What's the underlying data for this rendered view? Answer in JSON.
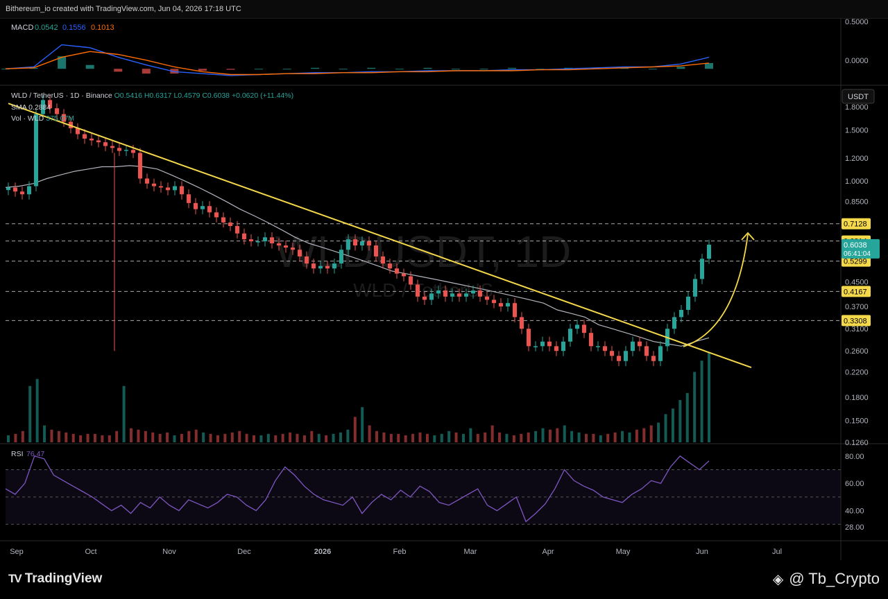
{
  "header": {
    "credit": "Bithereum_io created with TradingView.com, Jun 04, 2026 17:18 UTC"
  },
  "macd": {
    "label": "MACD",
    "v1": "0.0542",
    "v2": "0.1556",
    "v3": "0.1013",
    "ticks": [
      "0.5000",
      "0.0000"
    ]
  },
  "main": {
    "symbol": "WLD / TetherUS · 1D · Binance",
    "ohlc": {
      "o": "O0.5416",
      "h": "H0.6317",
      "l": "L0.4579",
      "c": "C0.6038",
      "chg": "+0.0620 (+11.44%)"
    },
    "sma_label": "SMA",
    "sma_value": "0.2884",
    "vol_label": "Vol · WLD",
    "vol_value": "375.07M",
    "watermark": "WLDUSDT, 1D",
    "watermark_sub": "WLD / TetherUS",
    "currency": "USDT",
    "price_ticks": [
      "1.8000",
      "1.5000",
      "1.2000",
      "1.0000",
      "0.8500",
      "0.4500",
      "0.3700",
      "0.3100",
      "0.2600",
      "0.2200",
      "0.1800",
      "0.1500",
      "0.1260"
    ],
    "levels": [
      "0.7128",
      "0.6214",
      "0.5299",
      "0.4167",
      "0.3308"
    ],
    "last_price": "0.6038",
    "countdown": "06:41:04"
  },
  "rsi": {
    "label": "RSI",
    "value": "76.47",
    "ticks": [
      "80.00",
      "60.00",
      "40.00",
      "28.00"
    ]
  },
  "xaxis": {
    "labels": [
      "Sep",
      "Oct",
      "Nov",
      "Dec",
      "2026",
      "Feb",
      "Mar",
      "Apr",
      "May",
      "Jun",
      "Jul"
    ]
  },
  "footer": {
    "brand": "TradingView",
    "handle": "@ Tb_Crypto"
  },
  "colors": {
    "up": "#26a69a",
    "down": "#ef5350",
    "trendline": "#f5d94a",
    "level": "#f5d94a",
    "sma": "#b2b5be",
    "rsi": "#7e57c2",
    "macd": "#2962ff",
    "signal": "#ff6d00",
    "last": "#26a69a"
  },
  "chart_data": [
    {
      "type": "line",
      "title": "MACD",
      "series": [
        {
          "name": "MACD",
          "values": [
            0.0,
            0.02,
            0.25,
            0.22,
            0.12,
            0.04,
            -0.03,
            -0.05,
            -0.07,
            -0.06,
            -0.05,
            -0.04,
            -0.04,
            -0.03,
            -0.03,
            -0.02,
            -0.02,
            -0.02,
            -0.01,
            -0.01,
            0.0,
            0.01,
            0.02,
            0.02,
            0.05,
            0.12
          ]
        },
        {
          "name": "Signal",
          "values": [
            0.0,
            0.01,
            0.12,
            0.18,
            0.15,
            0.09,
            0.02,
            -0.03,
            -0.06,
            -0.06,
            -0.05,
            -0.05,
            -0.04,
            -0.04,
            -0.03,
            -0.03,
            -0.02,
            -0.02,
            -0.02,
            -0.01,
            -0.01,
            0.0,
            0.01,
            0.02,
            0.03,
            0.06
          ]
        }
      ]
    },
    {
      "type": "line",
      "title": "WLD / TetherUS · 1D · Binance",
      "ylim": [
        0.126,
        2.0
      ],
      "candles": [
        0.95,
        0.92,
        0.9,
        0.96,
        1.7,
        1.9,
        1.78,
        1.7,
        1.6,
        1.52,
        1.45,
        1.4,
        1.38,
        1.36,
        1.32,
        1.3,
        1.27,
        1.28,
        1.25,
        1.02,
        0.98,
        0.96,
        0.95,
        0.93,
        0.96,
        0.9,
        0.84,
        0.8,
        0.82,
        0.78,
        0.75,
        0.72,
        0.7,
        0.66,
        0.63,
        0.62,
        0.62,
        0.64,
        0.61,
        0.6,
        0.59,
        0.58,
        0.55,
        0.52,
        0.5,
        0.51,
        0.5,
        0.52,
        0.58,
        0.63,
        0.6,
        0.62,
        0.6,
        0.55,
        0.52,
        0.5,
        0.48,
        0.47,
        0.44,
        0.4,
        0.39,
        0.41,
        0.42,
        0.4,
        0.41,
        0.4,
        0.41,
        0.42,
        0.4,
        0.39,
        0.38,
        0.37,
        0.38,
        0.34,
        0.31,
        0.27,
        0.27,
        0.28,
        0.27,
        0.26,
        0.28,
        0.31,
        0.32,
        0.3,
        0.27,
        0.27,
        0.26,
        0.25,
        0.24,
        0.26,
        0.28,
        0.27,
        0.25,
        0.24,
        0.27,
        0.31,
        0.34,
        0.36,
        0.4,
        0.46,
        0.54,
        0.6038
      ],
      "sma": [
        0.95,
        0.96,
        0.98,
        1.02,
        1.05,
        1.08,
        1.1,
        1.12,
        1.12,
        1.13,
        1.12,
        1.1,
        1.05,
        1.0,
        0.95,
        0.9,
        0.85,
        0.8,
        0.76,
        0.72,
        0.68,
        0.64,
        0.61,
        0.59,
        0.57,
        0.55,
        0.53,
        0.51,
        0.49,
        0.48,
        0.47,
        0.46,
        0.45,
        0.44,
        0.43,
        0.42,
        0.41,
        0.4,
        0.39,
        0.38,
        0.36,
        0.35,
        0.34,
        0.32,
        0.31,
        0.3,
        0.29,
        0.28,
        0.275,
        0.27,
        0.28,
        0.2884
      ],
      "trendline": [
        [
          0,
          1.85
        ],
        [
          110,
          0.228
        ]
      ],
      "levels": [
        0.7128,
        0.6214,
        0.5299,
        0.4167,
        0.3308
      ]
    },
    {
      "type": "line",
      "title": "RSI",
      "ylim": [
        20,
        85
      ],
      "series": [
        {
          "name": "RSI",
          "values": [
            56,
            52,
            60,
            80,
            78,
            66,
            62,
            58,
            54,
            50,
            45,
            40,
            44,
            38,
            46,
            42,
            50,
            44,
            40,
            48,
            45,
            42,
            46,
            52,
            50,
            44,
            40,
            48,
            62,
            72,
            66,
            58,
            52,
            48,
            46,
            44,
            50,
            38,
            46,
            52,
            48,
            55,
            50,
            58,
            54,
            46,
            44,
            48,
            52,
            56,
            44,
            40,
            45,
            50,
            32,
            38,
            45,
            56,
            70,
            62,
            58,
            55,
            50,
            48,
            46,
            52,
            56,
            62,
            60,
            72,
            80,
            75,
            70,
            76.47
          ]
        }
      ]
    },
    {
      "type": "bar",
      "title": "Vol · WLD",
      "values": [
        5,
        6,
        8,
        40,
        45,
        12,
        9,
        8,
        7,
        6,
        5,
        6,
        6,
        5,
        5,
        8,
        40,
        10,
        9,
        8,
        7,
        6,
        7,
        5,
        6,
        8,
        9,
        7,
        6,
        5,
        6,
        7,
        8,
        6,
        5,
        5,
        6,
        5,
        6,
        7,
        6,
        5,
        8,
        6,
        5,
        6,
        7,
        9,
        18,
        25,
        12,
        8,
        7,
        6,
        6,
        5,
        6,
        7,
        6,
        5,
        6,
        8,
        7,
        6,
        10,
        6,
        7,
        12,
        7,
        6,
        5,
        6,
        7,
        8,
        10,
        9,
        10,
        12,
        8,
        7,
        6,
        6,
        5,
        6,
        7,
        8,
        7,
        9,
        10,
        12,
        14,
        20,
        24,
        30,
        35,
        50,
        58,
        64
      ]
    }
  ]
}
